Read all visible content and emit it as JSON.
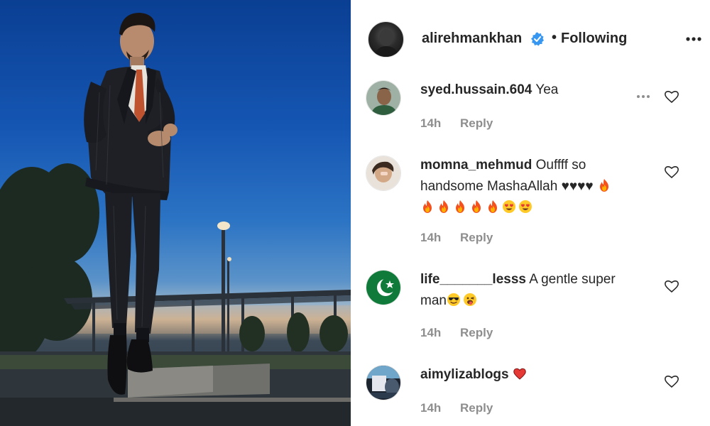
{
  "post": {
    "username": "alirehmankhan",
    "verified": true,
    "separator": "•",
    "follow_status": "Following",
    "more_icon": "more-horizontal-icon"
  },
  "comments": [
    {
      "username": "syed.hussain.604",
      "text": "Yea",
      "emojis": [],
      "time": "14h",
      "reply_label": "Reply",
      "show_more": true
    },
    {
      "username": "momna_mehmud",
      "text": "Ouffff so handsome MashaAllah ♥♥♥♥",
      "emojis": [
        "fire",
        "fire",
        "fire",
        "fire",
        "fire",
        "fire",
        "heart-eyes",
        "heart-eyes"
      ],
      "time": "14h",
      "reply_label": "Reply",
      "show_more": false
    },
    {
      "username": "life_______lesss",
      "text": "A gentle super man",
      "emojis": [
        "sunglasses-face",
        "tongue-wink-face"
      ],
      "time": "14h",
      "reply_label": "Reply",
      "show_more": false
    },
    {
      "username": "aimylizablogs",
      "text": "",
      "emojis": [
        "red-heart"
      ],
      "time": "14h",
      "reply_label": "Reply",
      "show_more": false
    }
  ],
  "colors": {
    "text": "#262626",
    "muted": "#8e8e8e",
    "verified_blue": "#3897f0",
    "sky_top": "#0a3f93"
  }
}
